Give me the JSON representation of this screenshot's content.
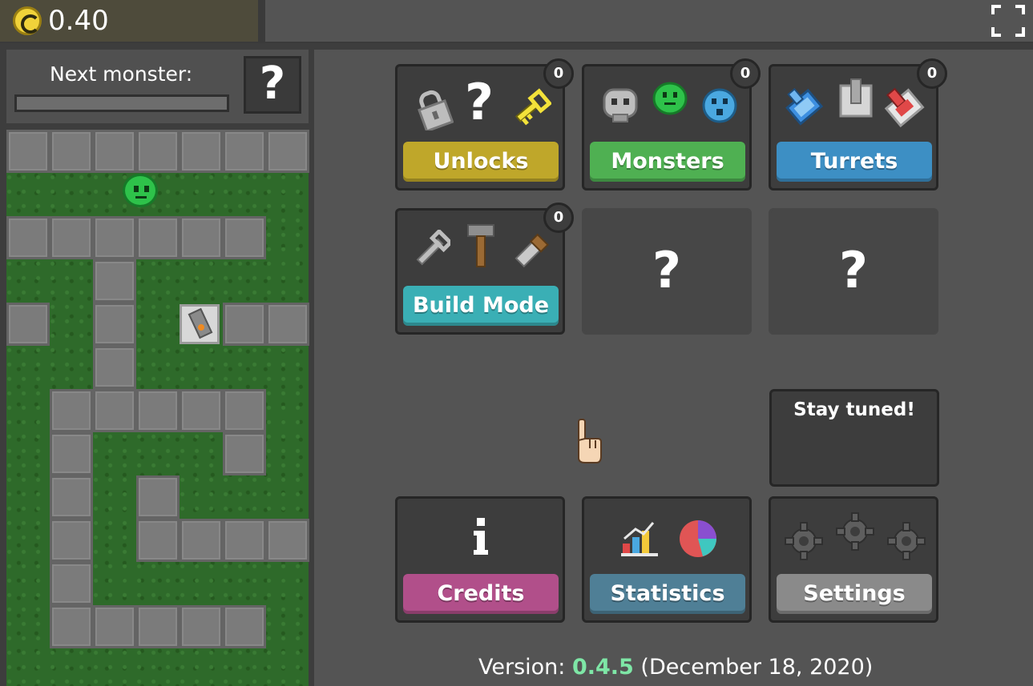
{
  "header": {
    "coins": "0.40",
    "coin_color": "#f0d23a"
  },
  "left_panel": {
    "next_monster_label": "Next monster:",
    "next_monster_unknown": "?",
    "next_monster_progress": 0
  },
  "menu": {
    "cards": [
      {
        "label": "Unlocks",
        "badge": "0",
        "color": "#bfa72a",
        "icons": [
          "lock-icon",
          "question-icon",
          "key-icon"
        ]
      },
      {
        "label": "Monsters",
        "badge": "0",
        "color": "#4fb052",
        "icons": [
          "skull-monster-icon",
          "green-slime-icon",
          "blue-slime-icon"
        ]
      },
      {
        "label": "Turrets",
        "badge": "0",
        "color": "#3d8fc4",
        "icons": [
          "blue-turret-icon",
          "grey-turret-icon",
          "red-turret-icon"
        ]
      },
      {
        "label": "Build Mode",
        "badge": "0",
        "color": "#3aafb5",
        "icons": [
          "wrench-icon",
          "hammer-icon",
          "saw-icon"
        ]
      }
    ],
    "locked_cards": [
      "?",
      "?"
    ],
    "stay_tuned": "Stay tuned!",
    "bottom_cards": [
      {
        "label": "Credits",
        "color": "#b14f8a",
        "icons": [
          "info-icon"
        ]
      },
      {
        "label": "Statistics",
        "color": "#4f7f96",
        "icons": [
          "bar-chart-icon",
          "pie-chart-icon"
        ]
      },
      {
        "label": "Settings",
        "color": "#8a8a8a",
        "icons": [
          "gear-icon",
          "gear-icon",
          "gear-icon"
        ]
      }
    ]
  },
  "footer": {
    "version_prefix": "Version: ",
    "version_number": "0.4.5",
    "version_date": " (December 18, 2020)"
  }
}
